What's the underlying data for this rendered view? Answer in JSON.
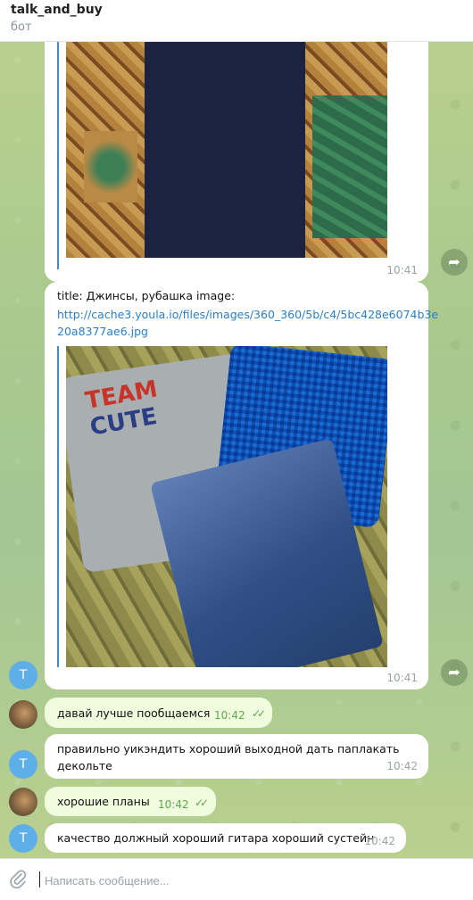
{
  "header": {
    "title": "talk_and_buy",
    "subtitle": "бот"
  },
  "messages": [
    {
      "id": "m1",
      "time": "10:41"
    },
    {
      "id": "m2",
      "title_line": "title: Джинсы, рубашка image:",
      "link_line1": "http://cache3.youla.io/files/images/360_360/5b/c4/5bc428e6074b3e",
      "link_line2": "20a8377ae6.jpg",
      "time": "10:41",
      "photo_logo_line1": "TEAM",
      "photo_logo_line2": "CUTE"
    },
    {
      "id": "m3",
      "text": "давай лучше пообщаемся",
      "time": "10:42"
    },
    {
      "id": "m4",
      "text_line1": "правильно уикэндить хороший выходной дать паплакать",
      "text_line2": "декольте",
      "time": "10:42"
    },
    {
      "id": "m5",
      "text": "хорошие планы",
      "time": "10:42"
    },
    {
      "id": "m6",
      "text": "качество должный хороший гитара хороший сустейн",
      "time": "10:42"
    }
  ],
  "avatars": {
    "bot_letter": "T"
  },
  "composer": {
    "placeholder": "Написать сообщение..."
  },
  "icons": {
    "share": "share-arrow-icon",
    "attach": "paperclip-icon",
    "read": "double-check-icon"
  },
  "colors": {
    "link": "#2a7fc9",
    "own_bubble": "#effdde",
    "accent": "#5eaee8"
  }
}
